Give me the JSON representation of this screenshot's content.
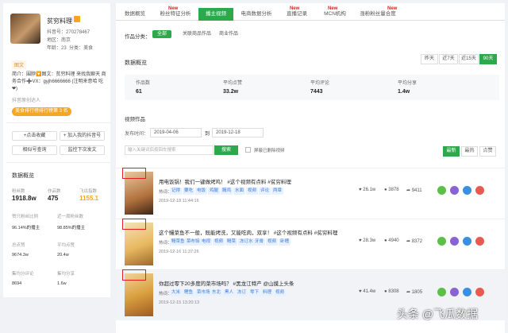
{
  "profile": {
    "name": "贫穷料理",
    "account_label": "抖音号：",
    "account_id": "270278467",
    "region_label": "地区：",
    "region": "南京",
    "age_label": "年龄：",
    "age": "23",
    "gender_label": "分类：",
    "category": "美食",
    "tag": "图文",
    "intro": "简介：围脖🔽图文：贫穷料理 来找我聊天 商务合作➕VX：gyjh6666666 (注明来意哈 吃❤)",
    "auth": "抖音原创达人",
    "rank": "美食排行榜排行榜第 3 名",
    "btn_collect": "+点击收藏",
    "btn_add": "+ 加入我的抖音号",
    "btn_compare": "相似号查询",
    "btn_export": "监控下次发文"
  },
  "overview_left": {
    "title": "数据概览",
    "stats": [
      {
        "label": "粉丝数",
        "value": "1918.8w"
      },
      {
        "label": "作品数",
        "value": "475"
      },
      {
        "label": "飞瓜指数",
        "value": "1155.1"
      },
      {
        "label": "赞只粉丝比例",
        "value": "96.14%的播主"
      },
      {
        "label": "近一周粉丝数",
        "value": "98.85%的播主"
      },
      {
        "label": "总点赞",
        "value": "9674.3w"
      },
      {
        "label": "平均点赞",
        "value": "20.4w"
      },
      {
        "label": "集均分评论",
        "value": "8694"
      },
      {
        "label": "集均分享",
        "value": "1.6w"
      }
    ]
  },
  "tabs": [
    {
      "label": "数据概览",
      "new": false
    },
    {
      "label": "粉丝特征分析",
      "new": true
    },
    {
      "label": "播主视频",
      "new": false,
      "active": true
    },
    {
      "label": "电商数据分析",
      "new": false
    },
    {
      "label": "直播记录",
      "new": true
    },
    {
      "label": "MCN机构",
      "new": true
    },
    {
      "label": "涨粉粉丝量合度",
      "new": true
    }
  ],
  "new_label": "New",
  "filters": {
    "category_label": "作品分类：",
    "all": "全部",
    "related": "关联商品作品",
    "goods": "商业作品"
  },
  "overview": {
    "title": "数据概览",
    "ranges": [
      "昨天",
      "近7天",
      "近15天",
      "90天"
    ],
    "items": [
      {
        "label": "作品数",
        "value": "61"
      },
      {
        "label": "平均点赞",
        "value": "33.2w"
      },
      {
        "label": "平均评论",
        "value": "7443"
      },
      {
        "label": "平均分享",
        "value": "1.4w"
      }
    ]
  },
  "videos_section": {
    "title": "视频作品",
    "date_label": "发布时间：",
    "start_date": "2019-04-06",
    "to": "到",
    "end_date": "2019-12-18",
    "search_placeholder": "输入关键词后按回车搜索",
    "search_btn": "搜索",
    "checkbox_label": "屏蔽已删除视频",
    "sort": [
      "最新",
      "最热",
      "点赞"
    ]
  },
  "videos": [
    {
      "title": "用电饭锅！我们一键做烤鸡！ #这个视频有点料 #贫穷料理",
      "hot_label": "热词：",
      "keywords": [
        "记得",
        "要吃",
        "电饭",
        "鸡腿",
        "腌鸡",
        "水面",
        "视频",
        "评论",
        "两章"
      ],
      "time": "2019-12-18 11:44:16",
      "likes": "26.1w",
      "comments": "3878",
      "shares": "9411"
    },
    {
      "title": "这个鳗菜鱼不一般，既能烤洗，又能吃肉，双享！ #这个视频有点料 #贫穷料理",
      "hot_label": "热词：",
      "keywords": [
        "鳗菜鱼",
        "菜布馅",
        "电视",
        "视频",
        "鳗菜",
        "冻订水",
        "牙膏",
        "视频",
        "卧槽"
      ],
      "time": "2019-12-16 11:37:26",
      "likes": "28.3w",
      "comments": "4940",
      "shares": "8372"
    },
    {
      "title": "你超过零下20多度的菜市场吗？ #黑龙江特产 @山摸上头条",
      "hot_label": "热词：",
      "keywords": [
        "大米",
        "鲤鱼",
        "菜市场",
        "东北",
        "黑人",
        "冻订",
        "零下",
        "料理",
        "视频"
      ],
      "time": "2019-12-15 13:20:13",
      "likes": "41.4w",
      "comments": "8308",
      "shares": "1805"
    }
  ],
  "watermark": "头条 @飞瓜数据",
  "colors": {
    "accent": "#2da84a",
    "new": "#e02020",
    "highlight_box": "#e02020",
    "orange": "#f5a623"
  }
}
